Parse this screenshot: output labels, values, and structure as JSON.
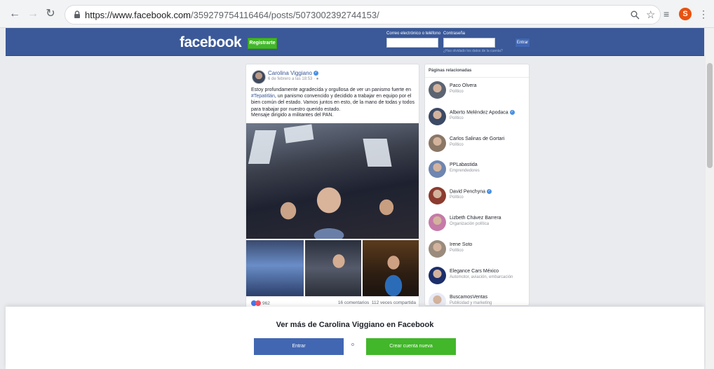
{
  "browser": {
    "url_host": "https://www.facebook.com",
    "url_path": "/359279754116464/posts/5073002392744153/",
    "profile_initial": "S"
  },
  "header": {
    "logo": "facebook",
    "register_label": "Registrarte",
    "email_label": "Correo electrónico o teléfono",
    "password_label": "Contraseña",
    "login_label": "Entrar",
    "forgot_label": "¿Has olvidado los datos de la cuenta?"
  },
  "post": {
    "author": "Carolina Viggiano",
    "meta": "6 de febrero a las 18:53 · ",
    "text_line1": "Estoy profundamente agradecida y orgullosa de ver un panismo fuerte en",
    "hashtag": "#Tepatitlán",
    "text_line2": ", un panismo convencido y decidido a trabajar en equipo por el bien común del estado. Vamos juntos en esto, de la mano de todas y todos para trabajar por nuestro querido estado.",
    "note": "Mensaje dirigido a militantes del PAN.",
    "reactions_count": "962",
    "comments": "16 comentarios",
    "shares": "112 veces compartida"
  },
  "related": {
    "title": "Páginas relacionadas",
    "items": [
      {
        "name": "Paco Olvera",
        "category": "Político",
        "verified": false,
        "color": "#5b6572"
      },
      {
        "name": "Alberto Meléndez Apodaca",
        "category": "Político",
        "verified": true,
        "color": "#3c4a66"
      },
      {
        "name": "Carlos Salinas de Gortari",
        "category": "Político",
        "verified": false,
        "color": "#8a7766"
      },
      {
        "name": "PPLabastida",
        "category": "Emprendedores",
        "verified": false,
        "color": "#6e86b0"
      },
      {
        "name": "David Penchyna",
        "category": "Político",
        "verified": true,
        "color": "#8c3b2f"
      },
      {
        "name": "Lizbeth Chávez Barrera",
        "category": "Organización política",
        "verified": false,
        "color": "#c57aa8"
      },
      {
        "name": "Irene Soto",
        "category": "Político",
        "verified": false,
        "color": "#9a8b7d"
      },
      {
        "name": "Elegance Cars México",
        "category": "Automotor, aviación, embarcación",
        "verified": false,
        "color": "#1c2f6b"
      },
      {
        "name": "BuscamosVentas",
        "category": "Publicidad y marketing",
        "verified": false,
        "color": "#e8eaf4"
      }
    ]
  },
  "overlay": {
    "title": "Ver más de Carolina Viggiano en Facebook",
    "login": "Entrar",
    "or": "o",
    "create": "Crear cuenta nueva"
  }
}
